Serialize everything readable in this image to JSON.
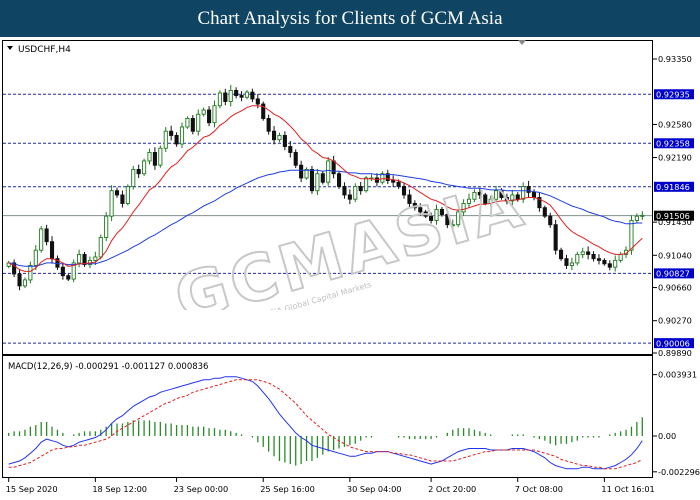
{
  "banner": {
    "title": "Chart Analysis for Clients of GCM Asia"
  },
  "colors": {
    "banner_bg": "#0f4562",
    "bull": "#1e7a1e",
    "bear": "#111111",
    "ma_fast": "#e02020",
    "ma_slow": "#1f3ee0",
    "level_line": "#1f2aa8",
    "price_line": "#7f8f8f",
    "price_tag": "#000000",
    "level_tag": "#0000cc",
    "macd_line": "#2233ee",
    "signal_line": "#e02020",
    "histogram": "#2a8a2a"
  },
  "watermark": {
    "text": "GCMASIA",
    "subtext": "GCM ASIA Global Capital Markets"
  },
  "chart_data": {
    "type": "candlestick",
    "symbol_label": "USDCHF,H4",
    "price_axis": {
      "range": [
        0.8989,
        0.9355
      ],
      "ticks": [
        0.9335,
        0.9258,
        0.9219,
        0.9143,
        0.9104,
        0.9066,
        0.9027,
        0.8989
      ],
      "tick_labels": [
        "0.93350",
        "0.92580",
        "0.92190",
        "0.91430",
        "0.91040",
        "0.90660",
        "0.90270",
        "0.89890"
      ]
    },
    "levels": [
      {
        "value": 0.92935,
        "label": "0.92935"
      },
      {
        "value": 0.92358,
        "label": "0.92358"
      },
      {
        "value": 0.91846,
        "label": "0.91846"
      },
      {
        "value": 0.90827,
        "label": "0.90827"
      },
      {
        "value": 0.90006,
        "label": "0.90006"
      }
    ],
    "current_price": {
      "value": 0.91506,
      "label": "0.91506"
    },
    "time_labels": [
      "15 Sep 2020",
      "18 Sep 12:00",
      "23 Sep 00:00",
      "25 Sep 16:00",
      "30 Sep 04:00",
      "2 Oct 20:00",
      "7 Oct 08:00",
      "11 Oct 16:01"
    ],
    "time_label_index": [
      0,
      16,
      31,
      47,
      63,
      78,
      94,
      110
    ],
    "closes": [
      0.9095,
      0.9082,
      0.9068,
      0.9075,
      0.9092,
      0.911,
      0.9135,
      0.912,
      0.91,
      0.909,
      0.908,
      0.9076,
      0.9095,
      0.9105,
      0.9093,
      0.9098,
      0.9102,
      0.9125,
      0.915,
      0.918,
      0.9175,
      0.9165,
      0.9185,
      0.9205,
      0.92,
      0.9215,
      0.9225,
      0.921,
      0.923,
      0.925,
      0.9245,
      0.9235,
      0.9255,
      0.9265,
      0.925,
      0.927,
      0.9275,
      0.926,
      0.928,
      0.9295,
      0.9285,
      0.9298,
      0.9292,
      0.929,
      0.9296,
      0.9288,
      0.9282,
      0.9265,
      0.925,
      0.924,
      0.9245,
      0.9232,
      0.9225,
      0.921,
      0.9195,
      0.9205,
      0.918,
      0.92,
      0.919,
      0.9215,
      0.92,
      0.9185,
      0.9175,
      0.917,
      0.9185,
      0.918,
      0.9195,
      0.9195,
      0.919,
      0.92,
      0.9192,
      0.919,
      0.9185,
      0.9175,
      0.9165,
      0.916,
      0.9155,
      0.915,
      0.9145,
      0.9158,
      0.9152,
      0.914,
      0.914,
      0.9155,
      0.9165,
      0.917,
      0.9178,
      0.9175,
      0.9165,
      0.917,
      0.918,
      0.9172,
      0.9168,
      0.9175,
      0.917,
      0.9185,
      0.9178,
      0.9172,
      0.916,
      0.915,
      0.914,
      0.911,
      0.91,
      0.9092,
      0.9095,
      0.9105,
      0.9108,
      0.9105,
      0.91,
      0.9098,
      0.9094,
      0.909,
      0.9098,
      0.9105,
      0.911,
      0.9145,
      0.915,
      0.9151
    ],
    "ma_fast": [
      0.9095,
      0.9092,
      0.9087,
      0.9085,
      0.9085,
      0.9089,
      0.9096,
      0.91,
      0.91,
      0.9098,
      0.9095,
      0.9091,
      0.9092,
      0.9094,
      0.9094,
      0.9095,
      0.9096,
      0.9101,
      0.9109,
      0.9121,
      0.913,
      0.9136,
      0.9145,
      0.9155,
      0.9163,
      0.9172,
      0.9181,
      0.9185,
      0.9192,
      0.9201,
      0.9208,
      0.9212,
      0.9219,
      0.9227,
      0.9231,
      0.9237,
      0.9243,
      0.9245,
      0.925,
      0.9257,
      0.9261,
      0.9267,
      0.9271,
      0.9274,
      0.9278,
      0.928,
      0.928,
      0.9279,
      0.9275,
      0.927,
      0.9267,
      0.9262,
      0.9256,
      0.9249,
      0.9241,
      0.9236,
      0.9228,
      0.9224,
      0.9219,
      0.9218,
      0.9215,
      0.921,
      0.9204,
      0.9199,
      0.9197,
      0.9194,
      0.9194,
      0.9194,
      0.9193,
      0.9194,
      0.9194,
      0.9193,
      0.9192,
      0.9189,
      0.9186,
      0.9182,
      0.9178,
      0.9174,
      0.917,
      0.9168,
      0.9165,
      0.9161,
      0.9158,
      0.9157,
      0.9158,
      0.916,
      0.9162,
      0.9164,
      0.9164,
      0.9165,
      0.9167,
      0.9168,
      0.9168,
      0.9169,
      0.9169,
      0.9171,
      0.9172,
      0.9172,
      0.917,
      0.9167,
      0.9163,
      0.9155,
      0.9146,
      0.9138,
      0.9132,
      0.9128,
      0.9125,
      0.9121,
      0.9117,
      0.9114,
      0.911,
      0.9107,
      0.9105,
      0.9105,
      0.9106,
      0.9112,
      0.9118,
      0.9124
    ],
    "ma_slow": [
      0.9095,
      0.9094,
      0.9092,
      0.9091,
      0.9091,
      0.9091,
      0.9093,
      0.9095,
      0.9095,
      0.9094,
      0.9094,
      0.9093,
      0.9093,
      0.9094,
      0.9094,
      0.9094,
      0.9094,
      0.9096,
      0.9098,
      0.9101,
      0.9104,
      0.9107,
      0.911,
      0.9114,
      0.9117,
      0.9121,
      0.9125,
      0.9128,
      0.9132,
      0.9136,
      0.914,
      0.9143,
      0.9147,
      0.9151,
      0.9154,
      0.9158,
      0.9162,
      0.9165,
      0.9168,
      0.9172,
      0.9176,
      0.9179,
      0.9183,
      0.9186,
      0.9189,
      0.9192,
      0.9195,
      0.9197,
      0.9199,
      0.92,
      0.9202,
      0.9203,
      0.9204,
      0.9204,
      0.9204,
      0.9204,
      0.9204,
      0.9204,
      0.9203,
      0.9204,
      0.9203,
      0.9203,
      0.9202,
      0.9201,
      0.9201,
      0.92,
      0.92,
      0.92,
      0.9199,
      0.9199,
      0.9199,
      0.9199,
      0.9198,
      0.9197,
      0.9196,
      0.9195,
      0.9194,
      0.9193,
      0.9191,
      0.919,
      0.9189,
      0.9187,
      0.9186,
      0.9185,
      0.9184,
      0.9183,
      0.9183,
      0.9183,
      0.9182,
      0.9181,
      0.9181,
      0.9181,
      0.918,
      0.918,
      0.918,
      0.918,
      0.918,
      0.9179,
      0.9178,
      0.9176,
      0.9174,
      0.9171,
      0.9168,
      0.9165,
      0.9162,
      0.916,
      0.9158,
      0.9155,
      0.9153,
      0.9151,
      0.9149,
      0.9146,
      0.9144,
      0.9143,
      0.9141,
      0.9141,
      0.9142,
      0.9142
    ],
    "macd": {
      "label": "MACD(12,26,9) -0.000291 -0.001127 0.000836",
      "range": [
        -0.0025,
        0.0041
      ],
      "ticks": [
        0.003931,
        0.0,
        -0.002296
      ],
      "tick_labels": [
        "0.003931",
        "0.00",
        "-0.002296"
      ],
      "main": [
        -0.0018,
        -0.0017,
        -0.0016,
        -0.0014,
        -0.0011,
        -0.0008,
        -0.0004,
        -0.0002,
        -0.0003,
        -0.0004,
        -0.0006,
        -0.0007,
        -0.0006,
        -0.0004,
        -0.0003,
        -0.0002,
        -0.0001,
        0.0001,
        0.0004,
        0.0008,
        0.0011,
        0.0013,
        0.0016,
        0.0019,
        0.0021,
        0.0023,
        0.0025,
        0.0026,
        0.0028,
        0.0029,
        0.003,
        0.0031,
        0.0032,
        0.0033,
        0.0034,
        0.0035,
        0.0036,
        0.0036,
        0.0037,
        0.0037,
        0.0038,
        0.0038,
        0.0038,
        0.0037,
        0.0036,
        0.0035,
        0.0032,
        0.0028,
        0.0024,
        0.0019,
        0.0014,
        0.001,
        0.0006,
        0.0002,
        -0.0001,
        -0.0003,
        -0.0006,
        -0.0007,
        -0.0008,
        -0.0009,
        -0.001,
        -0.0011,
        -0.0012,
        -0.0013,
        -0.0013,
        -0.0012,
        -0.0011,
        -0.0011,
        -0.001,
        -0.001,
        -0.001,
        -0.0011,
        -0.0012,
        -0.0013,
        -0.0014,
        -0.0015,
        -0.0016,
        -0.0017,
        -0.0018,
        -0.0017,
        -0.0016,
        -0.0014,
        -0.0012,
        -0.001,
        -0.0009,
        -0.0008,
        -0.0008,
        -0.0008,
        -0.0008,
        -0.0009,
        -0.0009,
        -0.0009,
        -0.0009,
        -0.0008,
        -0.0008,
        -0.0008,
        -0.0009,
        -0.001,
        -0.0012,
        -0.0014,
        -0.0017,
        -0.0019,
        -0.002,
        -0.0021,
        -0.0021,
        -0.0021,
        -0.002,
        -0.002,
        -0.0021,
        -0.0021,
        -0.0021,
        -0.002,
        -0.0019,
        -0.0017,
        -0.0015,
        -0.0012,
        -0.0008,
        -0.0003
      ],
      "signal": [
        -0.002,
        -0.002,
        -0.0019,
        -0.0018,
        -0.0017,
        -0.0015,
        -0.0013,
        -0.0011,
        -0.0009,
        -0.0008,
        -0.0008,
        -0.0007,
        -0.0007,
        -0.0006,
        -0.0006,
        -0.0005,
        -0.0004,
        -0.0003,
        -0.0002,
        0.0,
        0.0003,
        0.0005,
        0.0007,
        0.0009,
        0.0011,
        0.0013,
        0.0015,
        0.0017,
        0.0019,
        0.0021,
        0.0022,
        0.0024,
        0.0025,
        0.0026,
        0.0028,
        0.0029,
        0.003,
        0.0031,
        0.0032,
        0.0033,
        0.0034,
        0.0035,
        0.0036,
        0.0036,
        0.0036,
        0.0036,
        0.0036,
        0.0035,
        0.0034,
        0.0032,
        0.003,
        0.0027,
        0.0024,
        0.0021,
        0.0017,
        0.0013,
        0.001,
        0.0007,
        0.0004,
        0.0001,
        -0.0001,
        -0.0003,
        -0.0005,
        -0.0007,
        -0.0008,
        -0.0009,
        -0.001,
        -0.001,
        -0.001,
        -0.001,
        -0.001,
        -0.0011,
        -0.0011,
        -0.0012,
        -0.0012,
        -0.0013,
        -0.0014,
        -0.0015,
        -0.0016,
        -0.0016,
        -0.0016,
        -0.0016,
        -0.0016,
        -0.0015,
        -0.0014,
        -0.0013,
        -0.0012,
        -0.0011,
        -0.001,
        -0.001,
        -0.0009,
        -0.0009,
        -0.0009,
        -0.0009,
        -0.0009,
        -0.0009,
        -0.0009,
        -0.0009,
        -0.001,
        -0.0011,
        -0.0012,
        -0.0013,
        -0.0015,
        -0.0016,
        -0.0017,
        -0.0018,
        -0.0019,
        -0.0019,
        -0.002,
        -0.002,
        -0.0021,
        -0.0021,
        -0.0021,
        -0.002,
        -0.0019,
        -0.0018,
        -0.0017,
        -0.0015
      ]
    }
  }
}
